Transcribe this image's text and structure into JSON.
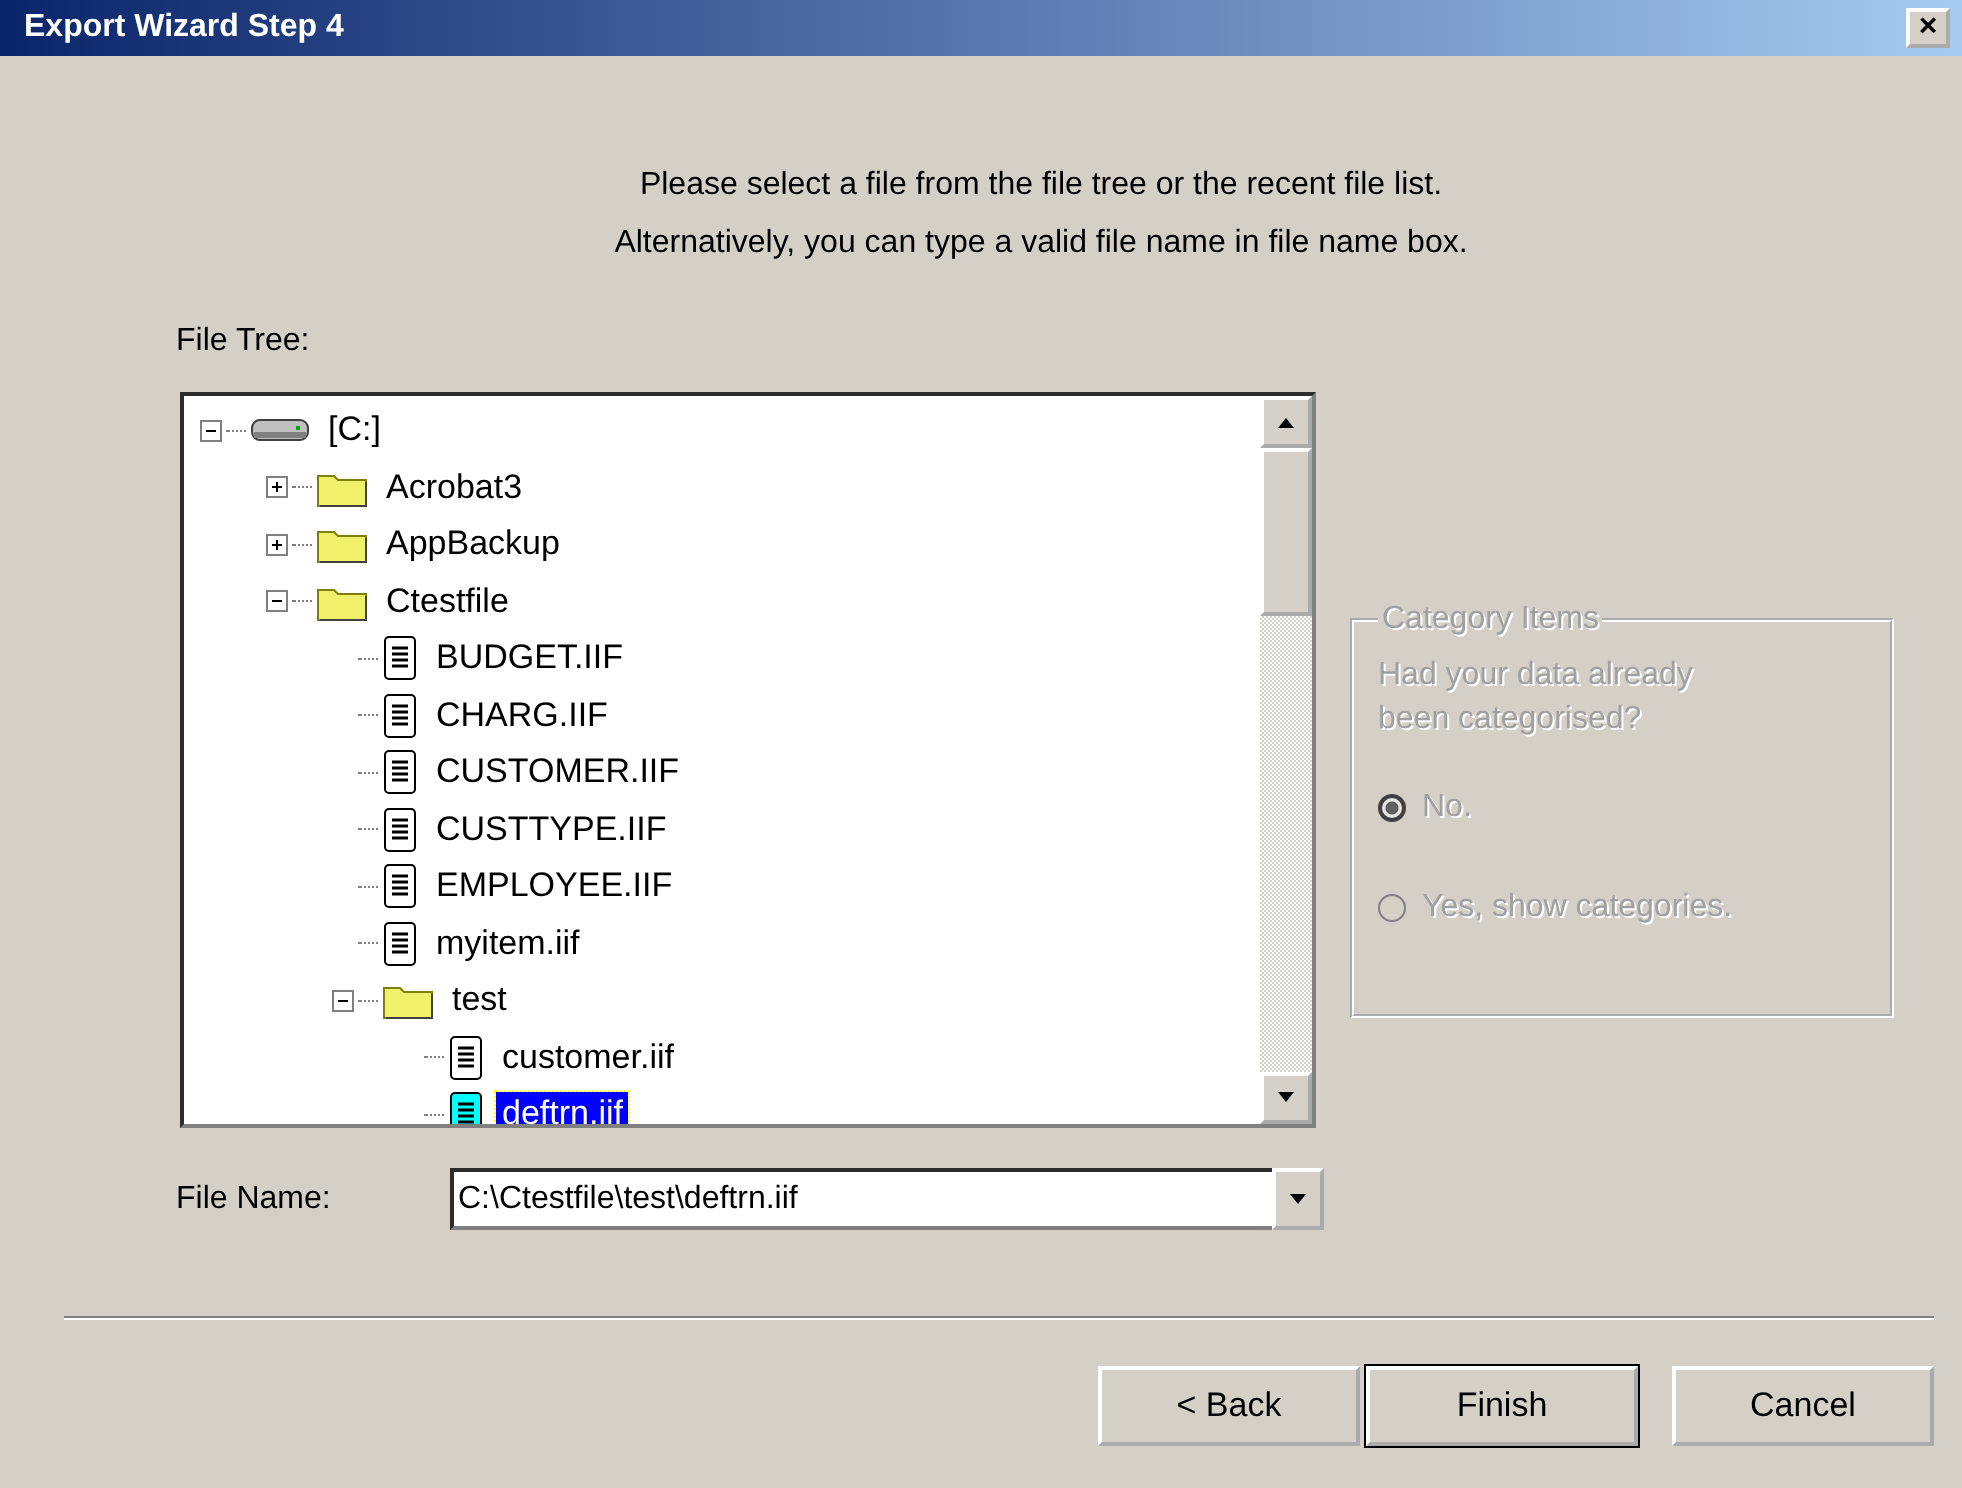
{
  "window": {
    "title": "Export Wizard Step 4",
    "close": "×"
  },
  "instructions": [
    "Please select a file from the file tree or the recent file list.",
    "Alternatively, you can type a valid file name in file name box."
  ],
  "file_tree": {
    "label": "File Tree:",
    "items": [
      {
        "kind": "drive",
        "label": "[C:]",
        "expanded": true,
        "selected": false,
        "children": [
          {
            "kind": "folder",
            "label": "Acrobat3",
            "expanded": false,
            "selected": false
          },
          {
            "kind": "folder",
            "label": "AppBackup",
            "expanded": false,
            "selected": false
          },
          {
            "kind": "folder",
            "label": "Ctestfile",
            "expanded": true,
            "selected": false,
            "children": [
              {
                "kind": "file",
                "label": "BUDGET.IIF",
                "selected": false
              },
              {
                "kind": "file",
                "label": "CHARG.IIF",
                "selected": false
              },
              {
                "kind": "file",
                "label": "CUSTOMER.IIF",
                "selected": false
              },
              {
                "kind": "file",
                "label": "CUSTTYPE.IIF",
                "selected": false
              },
              {
                "kind": "file",
                "label": "EMPLOYEE.IIF",
                "selected": false
              },
              {
                "kind": "file",
                "label": "myitem.iif",
                "selected": false
              },
              {
                "kind": "folder",
                "label": "test",
                "expanded": true,
                "selected": false,
                "children": [
                  {
                    "kind": "file",
                    "label": "customer.iif",
                    "selected": false
                  },
                  {
                    "kind": "file",
                    "label": "deftrn.iif",
                    "selected": true
                  }
                ]
              }
            ]
          }
        ]
      }
    ]
  },
  "file_name": {
    "label": "File Name:",
    "value": "C:\\Ctestfile\\test\\deftrn.iif"
  },
  "category_items": {
    "title": "Category Items",
    "disabled": true,
    "question": "Had your data already been categorised?",
    "options": [
      {
        "label": "No.",
        "selected": true
      },
      {
        "label": "Yes, show categories.",
        "selected": false
      }
    ]
  },
  "buttons": [
    "< Back",
    "Finish",
    "Cancel"
  ]
}
